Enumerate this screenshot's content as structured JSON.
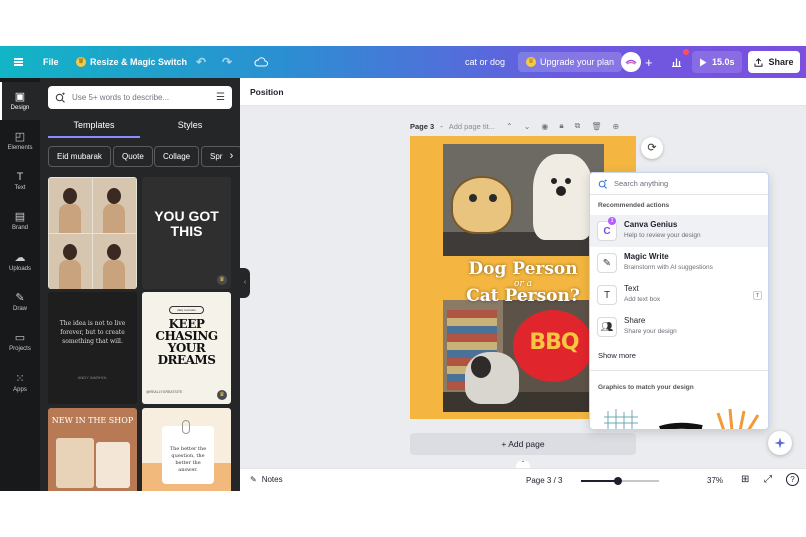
{
  "topbar": {
    "file": "File",
    "resize": "Resize & Magic Switch",
    "doc_name": "cat or dog",
    "upgrade": "Upgrade your plan",
    "duration": "15.0s",
    "share": "Share"
  },
  "rail": {
    "items": [
      {
        "label": "Design",
        "icon": "design-icon"
      },
      {
        "label": "Elements",
        "icon": "elements-icon"
      },
      {
        "label": "Text",
        "icon": "text-icon"
      },
      {
        "label": "Brand",
        "icon": "brand-icon"
      },
      {
        "label": "Uploads",
        "icon": "uploads-icon"
      },
      {
        "label": "Draw",
        "icon": "draw-icon"
      },
      {
        "label": "Projects",
        "icon": "projects-icon"
      },
      {
        "label": "Apps",
        "icon": "apps-icon"
      }
    ]
  },
  "panel": {
    "search_placeholder": "Use 5+ words to describe...",
    "tabs": [
      "Templates",
      "Styles"
    ],
    "chips": [
      "Eid mubarak",
      "Quote",
      "Collage",
      "Spring"
    ],
    "tiles": {
      "t2_text": "YOU GOT THIS",
      "t3_quote": "The idea is not to live forever, but to create something that will.",
      "t3_author": "ANDY WARHOL",
      "t4_pill": "daily reminder",
      "t4_head": "KEEP CHASING YOUR DREAMS",
      "t4_foot": "@REALLYGREATSITE",
      "t5_head": "NEW IN THE SHOP",
      "t6_text": "The better the question, the better the answer."
    }
  },
  "context_bar": {
    "position": "Position"
  },
  "page": {
    "title": "Page 3",
    "title_placeholder": "Add page tit...",
    "overlay_line1": "Dog Person",
    "overlay_line2": "or a",
    "overlay_line3": "Cat Person?",
    "pillow_text": "BBQ"
  },
  "add_page": "+ Add page",
  "dropdown": {
    "search_placeholder": "Search anything",
    "section_recommended": "Recommended actions",
    "items": [
      {
        "title": "Canva Genius",
        "subtitle": "Help to review your design",
        "icon": "canva-genius-icon"
      },
      {
        "title": "Magic Write",
        "subtitle": "Brainstorm with AI suggestions",
        "icon": "magic-write-icon"
      },
      {
        "title": "Text",
        "subtitle": "Add text box",
        "icon": "text-icon",
        "shortcut": "T"
      },
      {
        "title": "Share",
        "subtitle": "Share your design",
        "icon": "share-people-icon"
      }
    ],
    "show_more": "Show more",
    "section_graphics": "Graphics to match your design"
  },
  "footer": {
    "notes": "Notes",
    "page_count": "Page 3 / 3",
    "zoom": "37%",
    "zoom_fraction": 0.48
  },
  "colors": {
    "canvas_bg": "#f4b640",
    "accent": "#7b4fe0"
  }
}
